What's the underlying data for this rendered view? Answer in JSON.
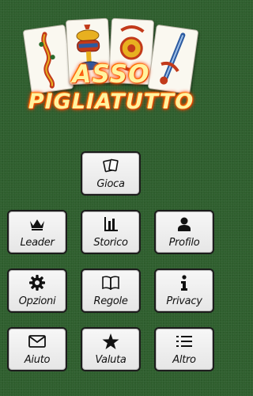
{
  "logo": {
    "title_line1": "ASSO",
    "title_line2": "PIGLIATUTTO"
  },
  "menu": {
    "play": "Gioca",
    "leader": "Leader",
    "history": "Storico",
    "profile": "Profilo",
    "options": "Opzioni",
    "rules": "Regole",
    "privacy": "Privacy",
    "help": "Aiuto",
    "rate": "Valuta",
    "more": "Altro"
  },
  "icons": [
    "cards-icon",
    "crown-icon",
    "bar-chart-icon",
    "user-icon",
    "gear-icon",
    "book-icon",
    "info-icon",
    "envelope-icon",
    "star-icon",
    "list-icon"
  ]
}
